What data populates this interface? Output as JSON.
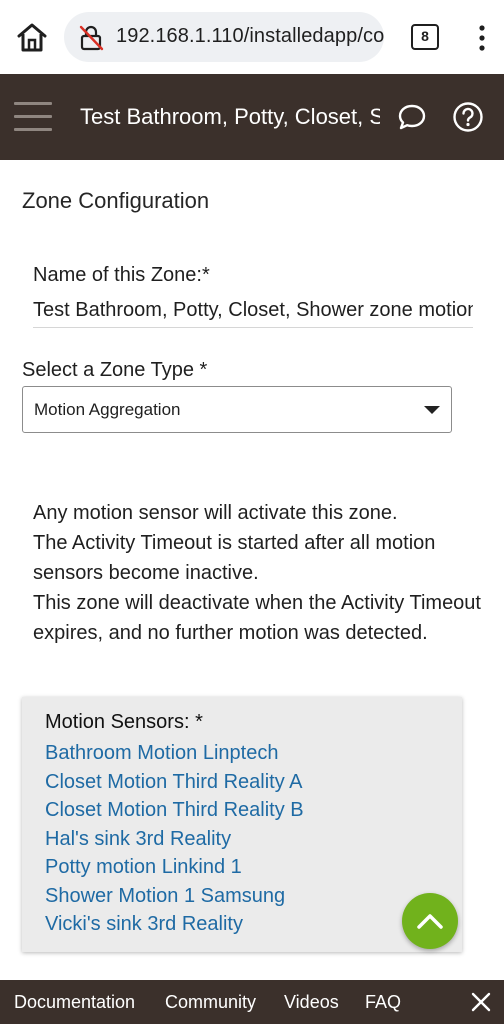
{
  "browser": {
    "url": "192.168.1.110/installedapp/co",
    "tab_count": "8"
  },
  "header": {
    "title": "Test Bathroom, Potty, Closet, Shower"
  },
  "page": {
    "section_title": "Zone Configuration",
    "name_label": "Name of this Zone:*",
    "name_value": "Test Bathroom, Potty, Closet, Shower zone motion",
    "type_label": "Select a Zone Type *",
    "type_value": "Motion Aggregation",
    "description": [
      "Any motion sensor will activate this zone.",
      "The Activity Timeout is started after all motion sensors become inactive.",
      "This zone will deactivate when the Activity Timeout expires, and no further motion was detected."
    ]
  },
  "sensors": {
    "title": "Motion Sensors: *",
    "items": [
      "Bathroom Motion Linptech",
      "Closet Motion Third Reality A",
      "Closet Motion Third Reality B",
      "Hal's sink 3rd Reality",
      "Potty motion Linkind 1",
      "Shower Motion 1 Samsung",
      "Vicki's sink 3rd Reality"
    ]
  },
  "footer": {
    "links": [
      "Documentation",
      "Community",
      "Videos",
      "FAQ"
    ]
  },
  "icons": {
    "home": "home-icon",
    "lock": "not-secure-lock-icon",
    "menu": "more-vert-icon",
    "hamburger": "hamburger-menu-icon",
    "chat": "chat-bubble-icon",
    "help": "help-circle-icon",
    "caret": "caret-down-icon",
    "fab": "chevron-up-icon",
    "close": "close-icon"
  },
  "colors": {
    "header_bg": "#3b302b",
    "link": "#1e6aa4",
    "fab": "#71b21c"
  }
}
